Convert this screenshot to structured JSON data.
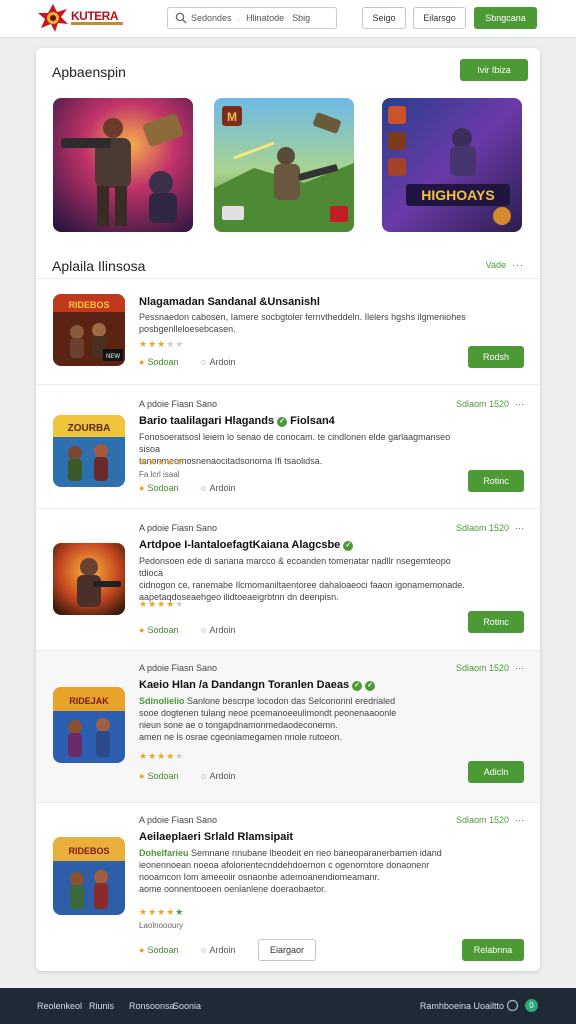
{
  "header": {
    "logo_text": "KUTERA",
    "search": {
      "part1": "Sedondes",
      "part2": "Hlinatode",
      "part3": "Sbig"
    },
    "btn_signin": "Seigo",
    "btn_secondary": "Eilarsgo",
    "btn_primary": "Sbngcana"
  },
  "featured": {
    "title": "Apbaenspin",
    "view_button": "Ivir Ibiza",
    "cards": [
      {
        "icon": "game-art-soldier",
        "label": ""
      },
      {
        "icon": "game-art-battlefield",
        "label": ""
      },
      {
        "icon": "game-art-heroes",
        "label": "HIGHOAYS"
      }
    ]
  },
  "list": {
    "title": "Aplaila Ilinsosa",
    "view_all": "Vade",
    "rows": [
      {
        "kicker": "",
        "meta": "",
        "title": "Nlagamadan Sandanal &Unsanishl",
        "desc_lines": [
          "Pessnaedon cabosen, Iamere socbgtoler fernvtheddeln. Ilelers hgshs ilgmeniohes",
          "posbgenlleloesebcasen."
        ],
        "rating": 3,
        "note": "",
        "tag": "Sodoan",
        "addon": "Ardoin",
        "button": "Rodsh",
        "thumb_text": "RIDEBOS",
        "thumb_badge": "NEW",
        "verified": false
      },
      {
        "kicker": "A pdoie Fiasn Sano",
        "meta": "Sdlaom 1520",
        "title": "Bario taalilagari Hlagands",
        "title_suffix": "Fiolsan4",
        "desc_lines": [
          "Fonosoeratsosl leiem lo senao de conocam. te cindlonen elde garlaagmanseo sisoa",
          "tanonmeomosnenaocitadsonoma Ifi tsaolidsa."
        ],
        "rating": 5,
        "note": "Fa lcrl isaal",
        "tag": "Sodoan",
        "addon": "Ardoin",
        "button": "Rotinc",
        "thumb_text": "ZOURBA",
        "verified": true
      },
      {
        "kicker": "A pdoie Fiasn Sano",
        "meta": "Sdlaom 1520",
        "title": "Artdpoe I-lantaloefagtKaiana Alagcsbe",
        "desc_lines": [
          "Pedonsoen ede di sanana marcco & ecoanden tomenatar nadllr nsegemteopo tdioca",
          "cidnogon ce, ranemabe Ilcmomaniltaentoree dahaloaeoci faaon igonamemonade.",
          "aapetaqdoseaehgeo ilidtoeaeigrbtnn dn deenpisn."
        ],
        "rating": 4,
        "note": "",
        "tag": "Sodoan",
        "addon": "Ardoin",
        "button": "Rotinc",
        "thumb_text": "",
        "verified": true
      },
      {
        "kicker": "A pdoie Fiasn Sano",
        "meta": "Sdlaom 1520",
        "title": "Kaeio Hlan /a Dandangn Toranlen Daeas",
        "highlight": "Sdinolielio",
        "desc_lines": [
          "Sanlone bescrpe locodon das Selcononnl eredrialed",
          "sooe dogtenen tulang neoe pcemanoeeulimondt peonenaaoonle",
          "nieun sone ae o tongapdnamonmedaodeconemn.",
          "amen ne ls osrae cgeoniamegamen nnole rutoeon."
        ],
        "rating": 4,
        "note": "",
        "tag": "Sodoan",
        "addon": "Ardoin",
        "button": "Adicln",
        "thumb_text": "RIDEJAK",
        "verified": true
      },
      {
        "kicker": "A pdoie Fiasn Sano",
        "meta": "Sdlaom 1520",
        "title": "Aeilaeplaeri Srlald Rlamsipait",
        "highlight": "Dohelfarieu",
        "desc_lines": [
          "Semnane nnubane lbeodeit en rieo baneoparanerbamen idand",
          "ieonennoean noeoa afolonentecnddehdoernon c ogenorntore donaonenr",
          "nooamcon Iom ameeoiir osnaonbe ademoanendiomeamanr.",
          "aome oonnentooeen oenlanlene doeraobaetor."
        ],
        "rating": 5,
        "note": "Laolnoooury",
        "tag": "Sodoan",
        "addon": "Ardoin",
        "secondary_button": "Eiargaor",
        "button": "Relabnna",
        "thumb_text": "RIDEBOS",
        "verified": false
      }
    ]
  },
  "footer": {
    "links": [
      "Reolenkeol",
      "Riunis",
      "Ronsoonsa",
      "Soonia"
    ],
    "right_text": "Ramhboeina",
    "right_text2": "Uoailtto",
    "badge": "0"
  },
  "colors": {
    "accent": "#4c9a35",
    "brand": "#b3121e",
    "footer": "#1f2a36"
  }
}
